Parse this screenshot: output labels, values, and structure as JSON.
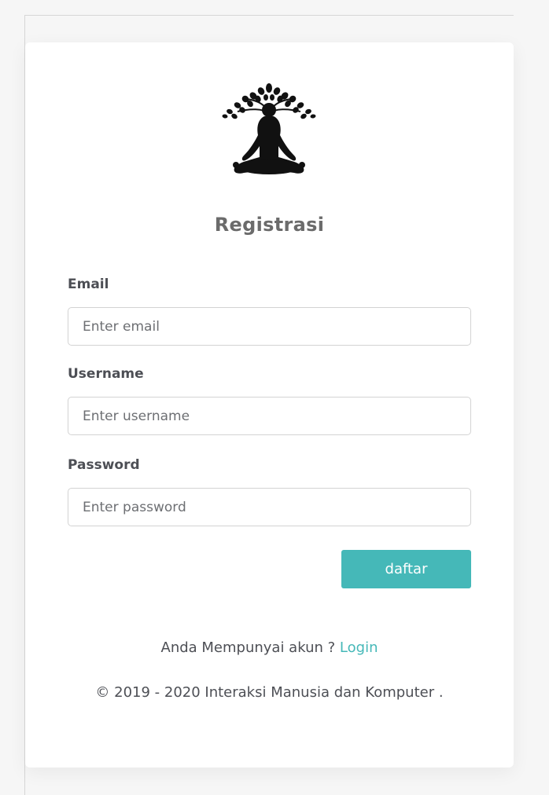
{
  "form": {
    "title": "Registrasi",
    "email": {
      "label": "Email",
      "placeholder": "Enter email",
      "value": ""
    },
    "username": {
      "label": "Username",
      "placeholder": "Enter username",
      "value": ""
    },
    "password": {
      "label": "Password",
      "placeholder": "Enter password",
      "value": ""
    },
    "submit_label": "daftar"
  },
  "footer": {
    "account_question": "Anda Mempunyai akun ?",
    "login_link": "Login",
    "copyright": "© 2019 - 2020 Interaksi Manusia dan Komputer ."
  },
  "colors": {
    "accent": "#45b8b8",
    "text": "#4d4f55",
    "title": "#6b6b6b"
  },
  "icons": {
    "logo": "meditation-tree-icon"
  }
}
